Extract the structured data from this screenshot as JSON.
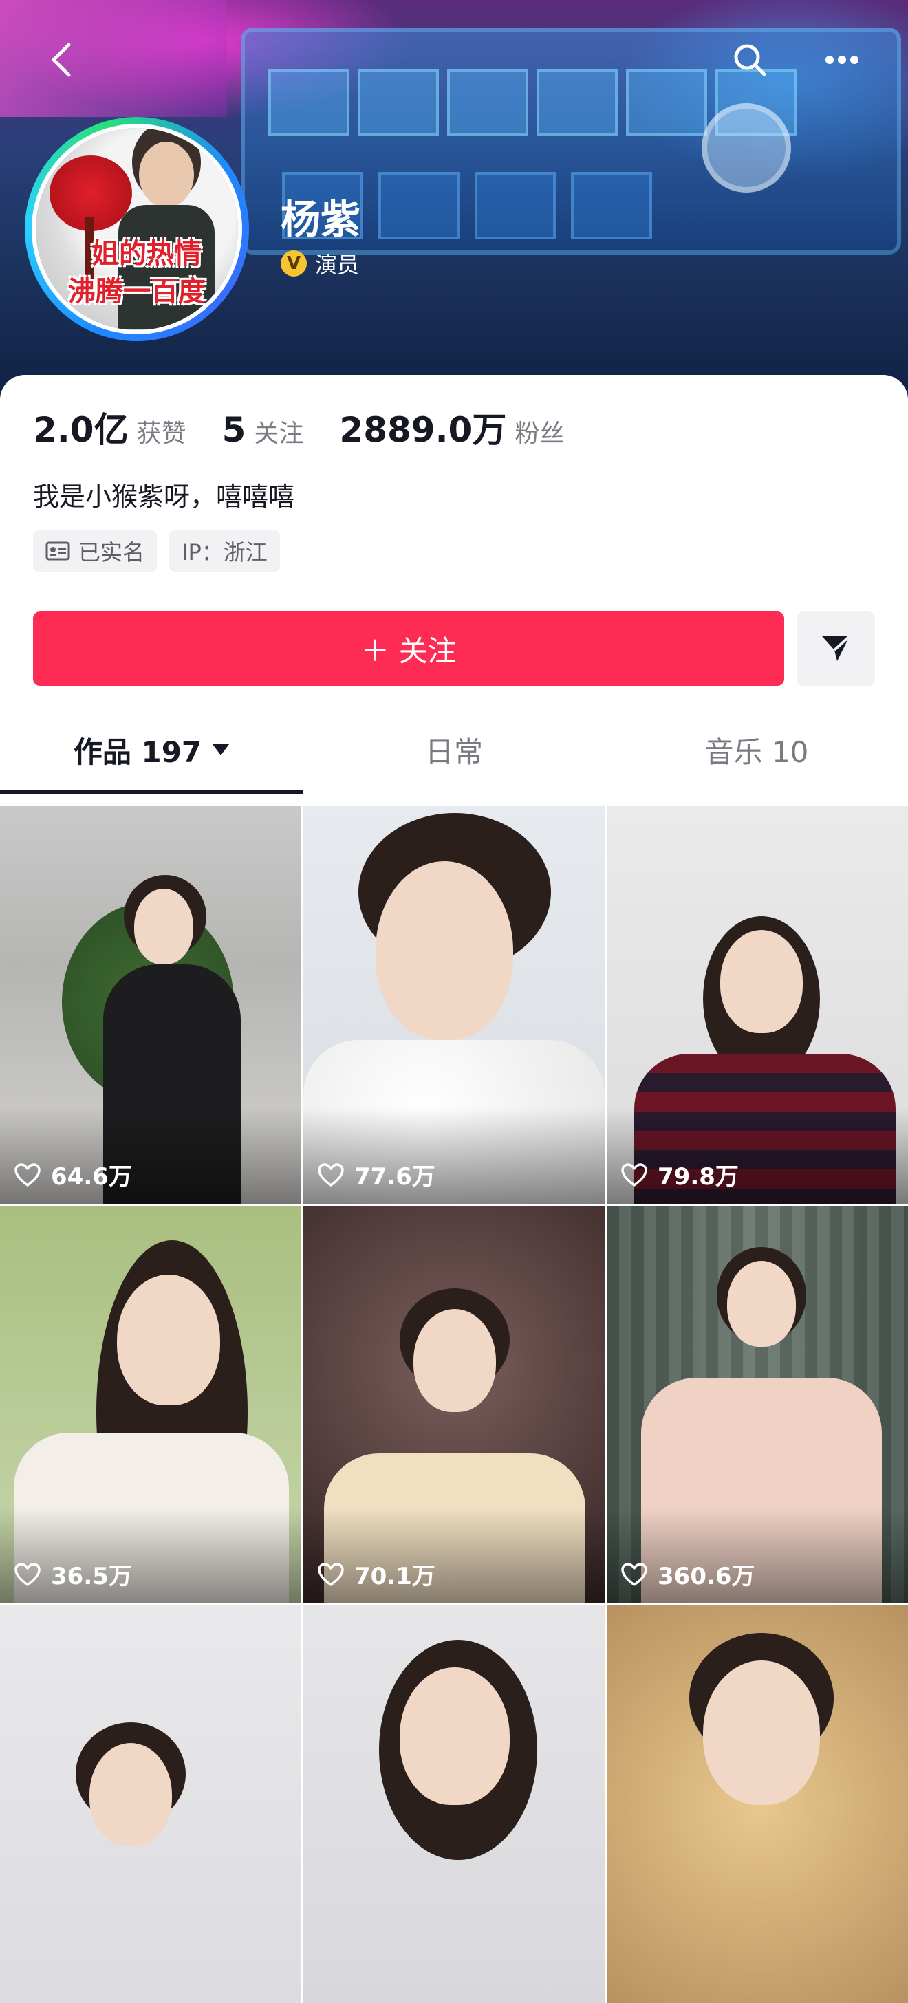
{
  "profile": {
    "name": "杨紫",
    "verify_label": "演员",
    "avatar_caption_1": "姐的热情",
    "avatar_caption_2": "沸腾一百度",
    "bio": "我是小猴紫呀，嘻嘻嘻"
  },
  "stats": [
    {
      "num": "2.0亿",
      "label": "获赞"
    },
    {
      "num": "5",
      "label": "关注"
    },
    {
      "num": "2889.0万",
      "label": "粉丝"
    }
  ],
  "tags": {
    "realname": "已实名",
    "ip": "IP：浙江"
  },
  "actions": {
    "follow_label": "＋ 关注"
  },
  "tabs": [
    {
      "label": "作品 197"
    },
    {
      "label": "日常"
    },
    {
      "label": "音乐 10"
    }
  ],
  "icons": {
    "back": "back-arrow-icon",
    "search": "search-icon",
    "more": "more-icon",
    "share": "share-send-icon",
    "like": "heart-icon"
  },
  "colors": {
    "accent": "#fe2c55",
    "text": "#161823",
    "muted": "#7a7b82"
  },
  "videos": [
    {
      "likes": "64.6万"
    },
    {
      "likes": "77.6万"
    },
    {
      "likes": "79.8万"
    },
    {
      "likes": "36.5万"
    },
    {
      "likes": "70.1万"
    },
    {
      "likes": "360.6万"
    },
    {
      "likes": ""
    },
    {
      "likes": ""
    },
    {
      "likes": ""
    }
  ]
}
